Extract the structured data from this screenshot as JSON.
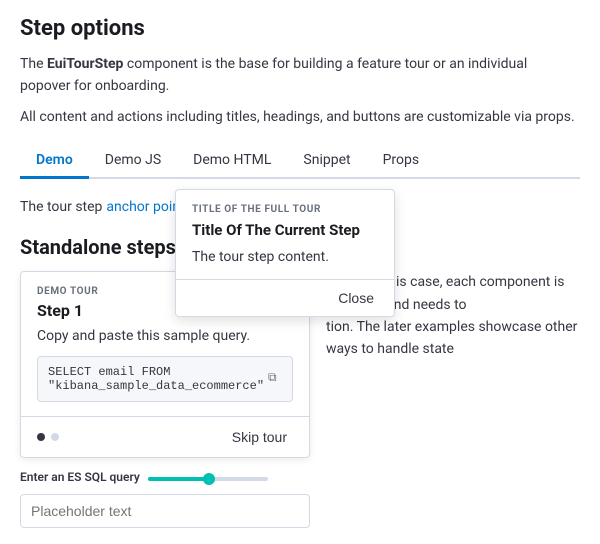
{
  "page": {
    "title": "Step options",
    "description1_prefix": "The ",
    "description1_bold": "EuiTourStep",
    "description1_suffix": " component is the base for building a feature tour or an individual popover for onboarding.",
    "description2": "All content and actions including titles, headings, and buttons are customizable via props."
  },
  "tabs": [
    {
      "label": "Demo",
      "active": true
    },
    {
      "label": "Demo JS",
      "active": false
    },
    {
      "label": "Demo HTML",
      "active": false
    },
    {
      "label": "Snippet",
      "active": false
    },
    {
      "label": "Props",
      "active": false
    }
  ],
  "demo": {
    "tour_step_label": "The tour step",
    "anchor_point_label": "anchor point"
  },
  "popover": {
    "subtitle": "TITLE OF THE FULL TOUR",
    "title": "Title Of The Current Step",
    "content": "The tour step content.",
    "close_label": "Close"
  },
  "standalone": {
    "section_title": "Standalone steps",
    "right_text_1": " props. In this case, each component is stateless and needs to",
    "right_text_2": "tion. The later examples showcase other ways to handle state"
  },
  "step_card": {
    "badge": "DEMO TOUR",
    "title": "Step 1",
    "description": "Copy and paste this sample query.",
    "code": "SELECT email FROM \"kibana_sample_data_ecommerce\"",
    "skip_label": "Skip tour",
    "dots": [
      true,
      false
    ]
  },
  "input_section": {
    "label": "Enter an ES SQL query",
    "placeholder": "Placeholder text"
  },
  "icons": {
    "copy": "⧉"
  }
}
